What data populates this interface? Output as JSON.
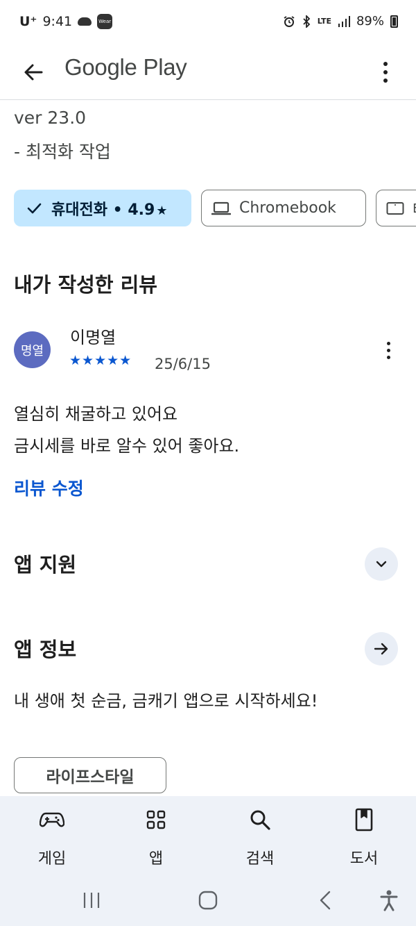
{
  "status_bar": {
    "carrier": "U⁺",
    "time": "9:41",
    "wear_label": "Wear",
    "lte": "LTE",
    "battery": "89%"
  },
  "app_bar": {
    "title": "Google Play"
  },
  "version": {
    "line1": "ver 23.0",
    "line2": "- 최적화 작업"
  },
  "device_chips": [
    {
      "label": "휴대전화 • 4.9",
      "star": "★",
      "selected": true,
      "icon": "check-icon"
    },
    {
      "label": "Chromebook",
      "selected": false,
      "icon": "laptop-icon"
    },
    {
      "label": "태",
      "selected": false,
      "icon": "tablet-icon"
    }
  ],
  "my_review": {
    "section_title": "내가 작성한 리뷰",
    "avatar_text": "명열",
    "reviewer_name": "이명열",
    "rating": 5,
    "stars": "★★★★★",
    "date": "25/6/15",
    "text_line1": "열심히 채굴하고 있어요",
    "text_line2": "금시세를 바로 알수 있어 좋아요.",
    "edit_label": "리뷰 수정"
  },
  "app_support": {
    "title": "앱 지원"
  },
  "app_info": {
    "title": "앱 정보",
    "description": "내 생애 첫 순금, 금캐기 앱으로 시작하세요!",
    "tag": "라이프스타일"
  },
  "bottom_nav": {
    "items": [
      {
        "label": "게임",
        "icon": "gamepad-icon"
      },
      {
        "label": "앱",
        "icon": "apps-grid-icon"
      },
      {
        "label": "검색",
        "icon": "search-icon"
      },
      {
        "label": "도서",
        "icon": "book-icon"
      }
    ]
  },
  "colors": {
    "accent": "#0b57d0",
    "chip_selected_bg": "#c2e7ff",
    "avatar_bg": "#5c6bc0",
    "nav_bg": "#eef2f8"
  }
}
